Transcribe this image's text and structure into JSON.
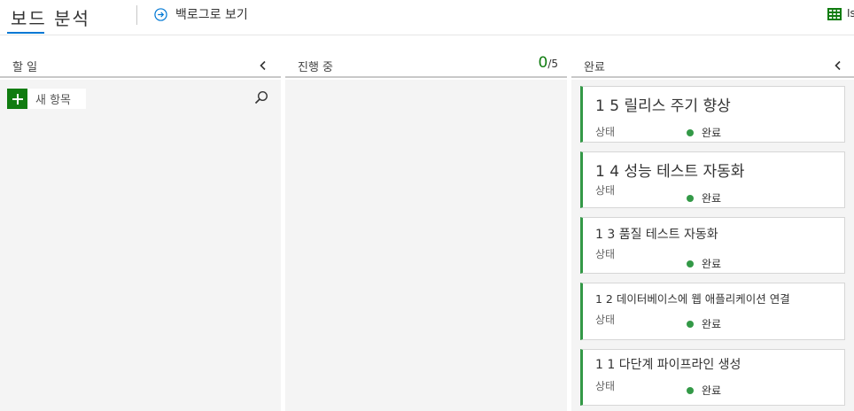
{
  "header": {
    "title": "보드 분석",
    "backlog_link": "백로그로 보기",
    "right_label": "Is"
  },
  "columns": [
    {
      "title": "할 일",
      "new_item_label": "새 항목"
    },
    {
      "title": "진행 중",
      "wip_current": "0",
      "wip_separator": "/",
      "wip_limit": "5"
    },
    {
      "title": "완료",
      "cards": [
        {
          "title": "1 5 릴리스 주기 향상",
          "field_label": "상태",
          "state": "완료"
        },
        {
          "title": "1 4 성능 테스트 자동화",
          "field_label": "상태",
          "state": "완료"
        },
        {
          "title": "1 3 품질 테스트 자동화",
          "field_label": "상태",
          "state": "완료"
        },
        {
          "title": "1 2 데이터베이스에 웹 애플리케이션 연결",
          "field_label": "상태",
          "state": "완료"
        },
        {
          "title": "1 1 다단계 파이프라인 생성",
          "field_label": "상태",
          "state": "완료"
        }
      ]
    }
  ],
  "colors": {
    "accent": "#0078d4",
    "new_item_green": "#107c10",
    "done_state_green": "#339947",
    "column_background": "#f4f4f4"
  },
  "icons": {
    "backlog": "circle-arrow-right-icon",
    "view": "grid-icon",
    "collapse": "chevron-left-icon",
    "search": "search-icon",
    "add": "plus-icon",
    "state": "status-dot-icon"
  }
}
